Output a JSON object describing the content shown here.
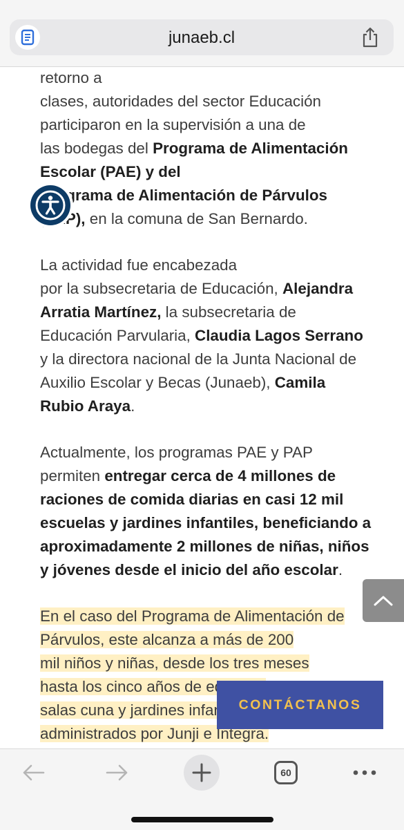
{
  "browser": {
    "url": "junaeb.cl",
    "tab_count": "60"
  },
  "article": {
    "p1": {
      "t1": "retorno a",
      "t2": "clases, autoridades del sector Educación participaron en la supervisión a una de",
      "t3": "las bodegas del ",
      "b1": "Programa de Alimentación Escolar (PAE) y del",
      "b2": "Programa de Alimentación de Párvulos (PAP),",
      "t4": " en la comuna de San Bernardo."
    },
    "p2": {
      "t1": "La actividad fue encabezada",
      "t2": "por la subsecretaria de Educación, ",
      "b1": "Alejandra Arratia Martínez,",
      "t3": " la subsecretaria de Educación Parvularia, ",
      "b2": "Claudia Lagos Serrano",
      "t4": " y la directora nacional de la Junta Nacional de Auxilio Escolar y Becas (Junaeb), ",
      "b3": "Camila Rubio Araya",
      "t5": "."
    },
    "p3": {
      "t1": "Actualmente, los programas PAE y PAP permiten ",
      "b1": "entregar cerca de 4 millones de raciones de comida diarias en casi 12 mil escuelas y jardines infantiles, beneficiando a aproximadamente 2 millones de niñas, niños y jóvenes desde el inicio del año escolar",
      "t2": "."
    },
    "p4": {
      "l1": "En el caso del Programa de Alimentación de",
      "l2": "Párvulos, este alcanza a más de 200",
      "l3": "mil niños y niñas, desde los tres meses",
      "l4": "hasta los cinco años de edad, en",
      "l5": "salas cuna y jardines infantiles",
      "l6": "administrados por Junji e Integra."
    }
  },
  "buttons": {
    "contact_label": "CONTÁCTANOS"
  },
  "icons": {
    "reader": "reader-mode-icon",
    "share": "share-icon",
    "accessibility": "accessibility-icon",
    "scroll_top": "chevron-up-icon",
    "back": "back-arrow-icon",
    "forward": "forward-arrow-icon",
    "new_tab": "plus-icon",
    "tabs": "tabs-icon",
    "more": "more-icon"
  },
  "colors": {
    "accessibility_bg": "#0d3b66",
    "contact_bg": "#3f51a3",
    "contact_text": "#f2c14e",
    "highlight": "#fff0c4"
  }
}
